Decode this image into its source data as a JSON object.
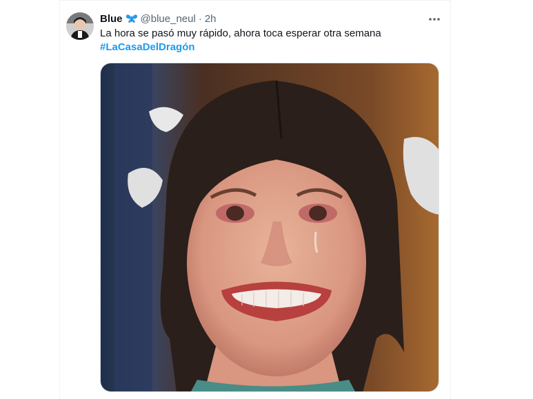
{
  "tweet": {
    "author": {
      "display_name": "Blue",
      "badge_icon": "butterfly-icon",
      "handle": "@blue_neul",
      "separator": "·",
      "timestamp": "2h"
    },
    "text": "La hora se pasó muy rápido, ahora toca esperar otra semana",
    "hashtag": "#LaCasaDelDragón",
    "more_icon": "more-options-icon",
    "media": {
      "type": "photo",
      "subject": "crying-smiling-woman"
    }
  },
  "colors": {
    "accent": "#1d9bf0",
    "text_primary": "#0f1419",
    "text_secondary": "#536471",
    "badge_blue": "#1d9bf0"
  }
}
